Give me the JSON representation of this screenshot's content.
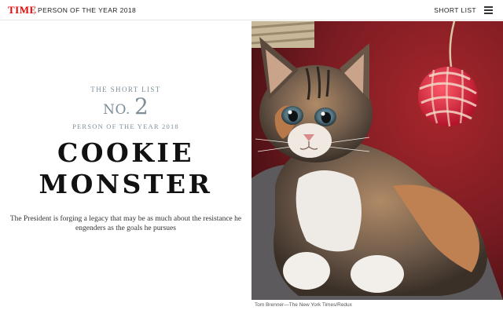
{
  "header": {
    "logo": "TIME",
    "section": "PERSON OF THE YEAR 2018",
    "nav_link": "SHORT LIST",
    "menu_icon": "hamburger-menu-icon"
  },
  "article": {
    "eyebrow": "THE SHORT LIST",
    "rank_prefix": "NO.",
    "rank_number": "2",
    "subtitle": "PERSON OF THE YEAR 2018",
    "headline_line1": "COOKIE",
    "headline_line2": "MONSTER",
    "dek": "The President is forging a legacy that may be as much about the resistance he engenders as the goals he pursues"
  },
  "photo": {
    "credit": "Tom Brenner—The New York Times/Redux"
  },
  "colors": {
    "brand": "#e90606",
    "muted_accent": "#7d8e99",
    "photo_background": "#7a1c22"
  }
}
